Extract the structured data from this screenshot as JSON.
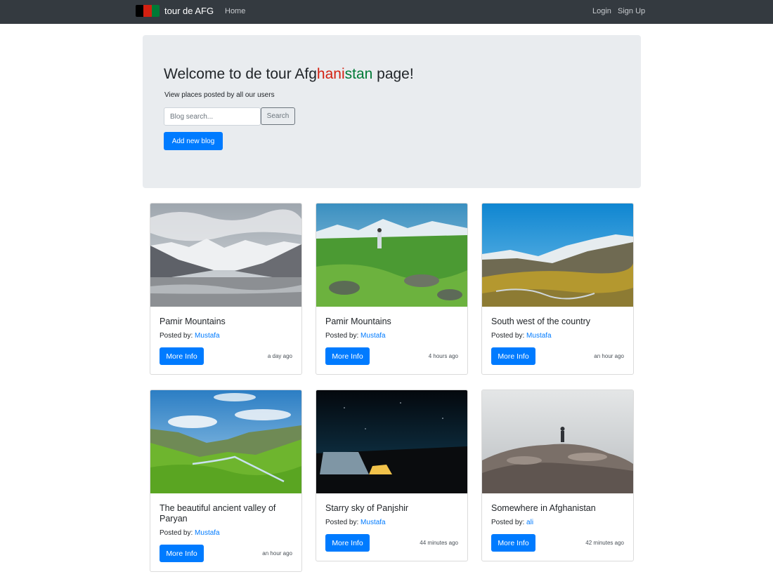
{
  "navbar": {
    "brand": "tour de AFG",
    "flag_colors": [
      "#000000",
      "#d32011",
      "#007a36"
    ],
    "links": {
      "home": "Home",
      "login": "Login",
      "signup": "Sign Up"
    }
  },
  "jumbotron": {
    "title_prefix": "Welcome to de tour Afg",
    "title_red": "hani",
    "title_green": "stan",
    "title_suffix": " page!",
    "title_colors": {
      "red": "#d32011",
      "green": "#007a36"
    },
    "lead": "View places posted by all our users",
    "search": {
      "placeholder": "Blog search...",
      "button": "Search"
    },
    "add_button": "Add new blog"
  },
  "posted_by_label": "Posted by:",
  "more_info_label": "More Info",
  "cards": [
    {
      "title": "Pamir Mountains",
      "author": "Mustafa",
      "time": "a day ago",
      "image": "snowy-mountain-valley"
    },
    {
      "title": "Pamir Mountains",
      "author": "Mustafa",
      "time": "4 hours ago",
      "image": "green-meadow-with-hiker"
    },
    {
      "title": "South west of the country",
      "author": "Mustafa",
      "time": "an hour ago",
      "image": "golden-valley-blue-sky"
    },
    {
      "title": "The beautiful ancient valley of Paryan",
      "author": "Mustafa",
      "time": "an hour ago",
      "image": "green-valley-river"
    },
    {
      "title": "Starry sky of Panjshir",
      "author": "Mustafa",
      "time": "44 minutes ago",
      "image": "night-sky-tent"
    },
    {
      "title": "Somewhere in Afghanistan",
      "author": "ali",
      "time": "42 minutes ago",
      "image": "hiker-on-rocks-fog"
    }
  ]
}
